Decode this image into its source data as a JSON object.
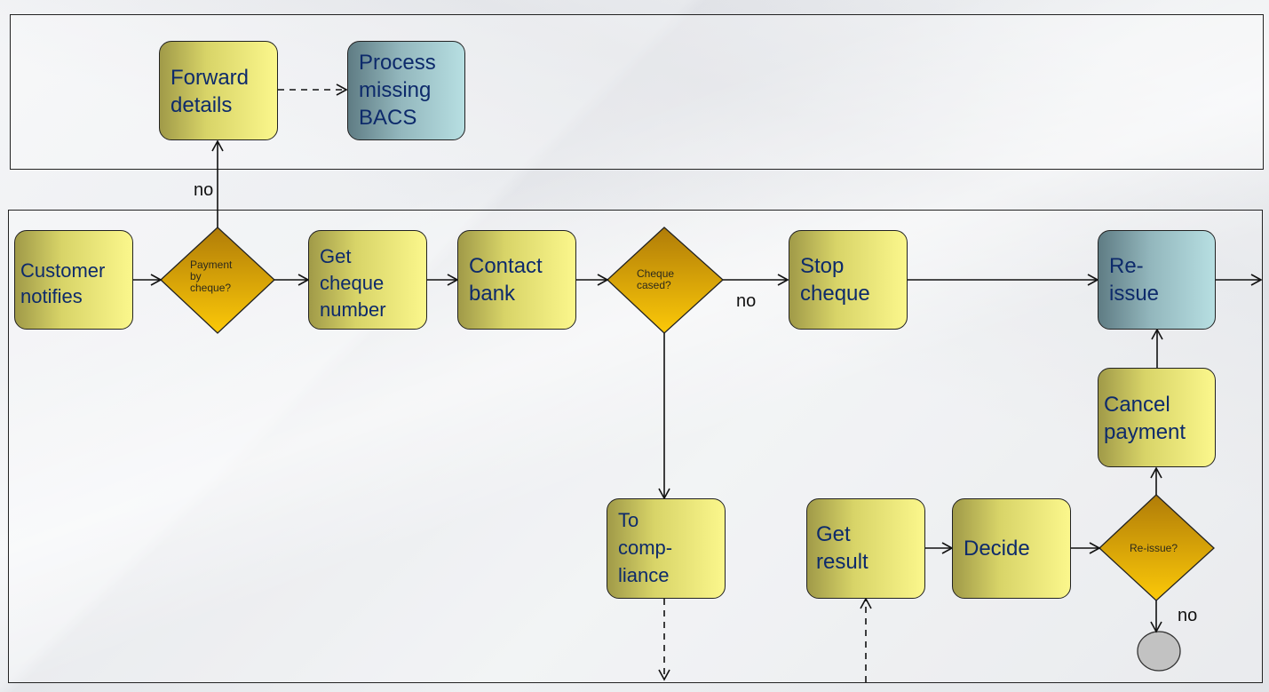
{
  "lanes": [
    {
      "id": "top-lane",
      "label": ""
    },
    {
      "id": "main-lane",
      "label": ""
    }
  ],
  "nodes": {
    "forward_details": "Forward details",
    "process_missing_bacs": "Process missing BACS",
    "customer_notifies": "Customer notifies",
    "payment_by_cheque": "Payment by cheque?",
    "get_cheque_number": "Get cheque number",
    "contact_bank": "Contact bank",
    "cheque_cashed": "Cheque cased?",
    "stop_cheque": "Stop cheque",
    "reissue": "Re-issue",
    "cancel_payment": "Cancel payment",
    "to_compliance": "To comp-liance",
    "get_result": "Get result",
    "decide": "Decide",
    "reissue_decision": "Re-issue?",
    "end": ""
  },
  "node_lines": {
    "forward_details": [
      "Forward",
      "details"
    ],
    "process_missing_bacs": [
      "Process",
      "missing",
      "BACS"
    ],
    "customer_notifies": [
      "Customer",
      "notifies"
    ],
    "payment_by_cheque": [
      "Payment",
      "by",
      "cheque?"
    ],
    "get_cheque_number": [
      "Get",
      "cheque",
      "number"
    ],
    "contact_bank": [
      "Contact",
      "bank"
    ],
    "cheque_cashed": [
      "Cheque",
      "cased?"
    ],
    "stop_cheque": [
      "Stop",
      "cheque"
    ],
    "reissue": [
      "Re-",
      "issue"
    ],
    "cancel_payment": [
      "Cancel",
      "payment"
    ],
    "to_compliance": [
      "To",
      "comp-",
      "liance"
    ],
    "get_result": [
      "Get",
      "result"
    ],
    "decide": [
      "Decide"
    ],
    "reissue_decision": [
      "Re-issue?"
    ]
  },
  "edge_labels": {
    "payment_no": "no",
    "cheque_no": "no",
    "reissue_no": "no"
  },
  "edges": [
    {
      "from": "customer_notifies",
      "to": "payment_by_cheque",
      "style": "solid"
    },
    {
      "from": "payment_by_cheque",
      "to": "get_cheque_number",
      "style": "solid"
    },
    {
      "from": "payment_by_cheque",
      "to": "forward_details",
      "style": "solid",
      "label": "no"
    },
    {
      "from": "forward_details",
      "to": "process_missing_bacs",
      "style": "dashed"
    },
    {
      "from": "get_cheque_number",
      "to": "contact_bank",
      "style": "solid"
    },
    {
      "from": "contact_bank",
      "to": "cheque_cashed",
      "style": "solid"
    },
    {
      "from": "cheque_cashed",
      "to": "stop_cheque",
      "style": "solid",
      "label": "no"
    },
    {
      "from": "cheque_cashed",
      "to": "to_compliance",
      "style": "solid"
    },
    {
      "from": "stop_cheque",
      "to": "reissue",
      "style": "solid"
    },
    {
      "from": "reissue",
      "to": "exit",
      "style": "solid"
    },
    {
      "from": "cancel_payment",
      "to": "reissue",
      "style": "solid"
    },
    {
      "from": "reissue_decision",
      "to": "cancel_payment",
      "style": "solid"
    },
    {
      "from": "get_result",
      "to": "decide",
      "style": "solid"
    },
    {
      "from": "decide",
      "to": "reissue_decision",
      "style": "solid"
    },
    {
      "from": "reissue_decision",
      "to": "end",
      "style": "solid",
      "label": "no"
    },
    {
      "from": "to_compliance",
      "to": "offpage",
      "style": "dashed"
    },
    {
      "from": "offpage",
      "to": "get_result",
      "style": "dashed"
    }
  ]
}
